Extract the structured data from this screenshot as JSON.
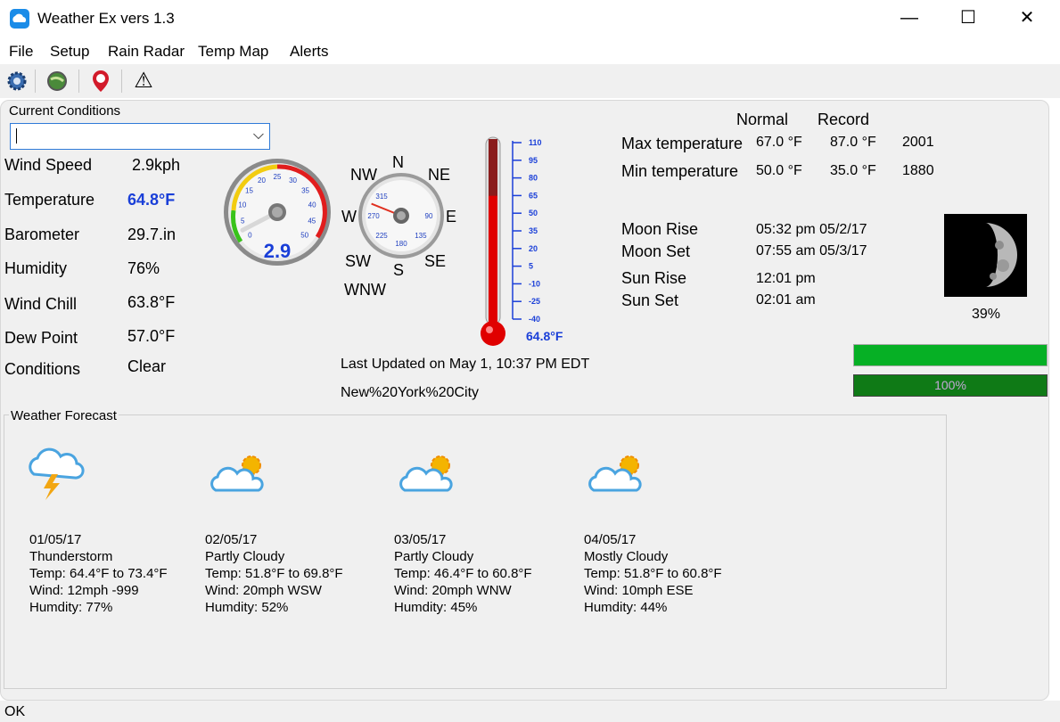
{
  "window": {
    "title": "Weather Ex vers 1.3",
    "minimize_glyph": "—",
    "maximize_glyph": "☐",
    "close_glyph": "✕"
  },
  "menu": [
    "File",
    "Setup",
    "Rain Radar",
    "Temp Map",
    "Alerts"
  ],
  "toolbar": {
    "icons": [
      "settings-gear-icon",
      "globe-icon",
      "alert-pin-icon",
      "warning-triangle-icon"
    ],
    "warning_glyph": "⚠"
  },
  "current_conditions": {
    "group_label": "Current Conditions",
    "location_value": "",
    "dropdown_glyph": "⌵",
    "rows": [
      {
        "label": "Wind Speed",
        "value": "2.9kph"
      },
      {
        "label": "Temperature",
        "value": "64.8°F"
      },
      {
        "label": "Barometer",
        "value": "29.7.in"
      },
      {
        "label": "Humidity",
        "value": "76%"
      },
      {
        "label": "Wind Chill",
        "value": "63.8°F"
      },
      {
        "label": "Dew Point",
        "value": "57.0°F"
      },
      {
        "label": "Conditions",
        "value": "Clear"
      }
    ]
  },
  "speed_gauge": {
    "value_label": "2.9",
    "value": 2.9,
    "max": 60,
    "ticks": [
      "0",
      "5",
      "10",
      "15",
      "20",
      "25",
      "30",
      "35",
      "40",
      "45",
      "50"
    ]
  },
  "compass": {
    "directions": {
      "n": "N",
      "ne": "NE",
      "e": "E",
      "se": "SE",
      "s": "S",
      "sw": "SW",
      "w": "W",
      "nw": "NW"
    },
    "inner_ticks": [
      "315",
      "90",
      "135",
      "180",
      "225",
      "270"
    ],
    "current_direction": "WNW",
    "bearing_deg": 292
  },
  "thermometer": {
    "scale": [
      "110",
      "95",
      "80",
      "65",
      "50",
      "35",
      "20",
      "5",
      "-10",
      "-25",
      "-40"
    ],
    "reading": "64.8°F",
    "value": 64.8,
    "min": -40,
    "max": 110
  },
  "last_updated": "Last Updated on May 1, 10:37 PM EDT",
  "city": "New%20York%20City",
  "records": {
    "headers": {
      "normal": "Normal",
      "record": "Record"
    },
    "rows": [
      {
        "label": "Max temperature",
        "normal": "67.0 °F",
        "record": "87.0 °F",
        "year": "2001"
      },
      {
        "label": "Min temperature",
        "normal": "50.0 °F",
        "record": "35.0 °F",
        "year": "1880"
      }
    ]
  },
  "astro": [
    {
      "label": "Moon Rise",
      "value": "05:32 pm 05/2/17"
    },
    {
      "label": "Moon Set",
      "value": "07:55 am 05/3/17"
    },
    {
      "label": "Sun Rise",
      "value": "12:01 pm"
    },
    {
      "label": "Sun Set",
      "value": "02:01 am"
    }
  ],
  "moon_phase": {
    "illumination": "39%"
  },
  "progress": {
    "bar1": 1.0,
    "bar2": 1.0,
    "bar2_label": "100%"
  },
  "forecast": {
    "group_label": "Weather Forecast",
    "days": [
      {
        "icon": "thunderstorm-icon",
        "date": "01/05/17",
        "condition": "Thunderstorm",
        "temp": "Temp: 64.4°F to 73.4°F",
        "wind": "Wind: 12mph -999",
        "humidity": "Humdity: 77%"
      },
      {
        "icon": "partly-cloudy-icon",
        "date": "02/05/17",
        "condition": "Partly Cloudy",
        "temp": "Temp: 51.8°F to 69.8°F",
        "wind": "Wind: 20mph WSW",
        "humidity": "Humdity: 52%"
      },
      {
        "icon": "partly-cloudy-icon",
        "date": "03/05/17",
        "condition": "Partly Cloudy",
        "temp": "Temp: 46.4°F to 60.8°F",
        "wind": "Wind: 20mph WNW",
        "humidity": "Humdity: 45%"
      },
      {
        "icon": "mostly-cloudy-icon",
        "date": "04/05/17",
        "condition": "Mostly Cloudy",
        "temp": "Temp: 51.8°F to 60.8°F",
        "wind": "Wind: 10mph ESE",
        "humidity": "Humdity: 44%"
      }
    ]
  },
  "status": {
    "text": "OK"
  },
  "colors": {
    "accent_blue": "#1a3fd8",
    "bar_green": "#06b025",
    "bar_dark_green": "#0f7a16",
    "thermo_red": "#e00000"
  }
}
